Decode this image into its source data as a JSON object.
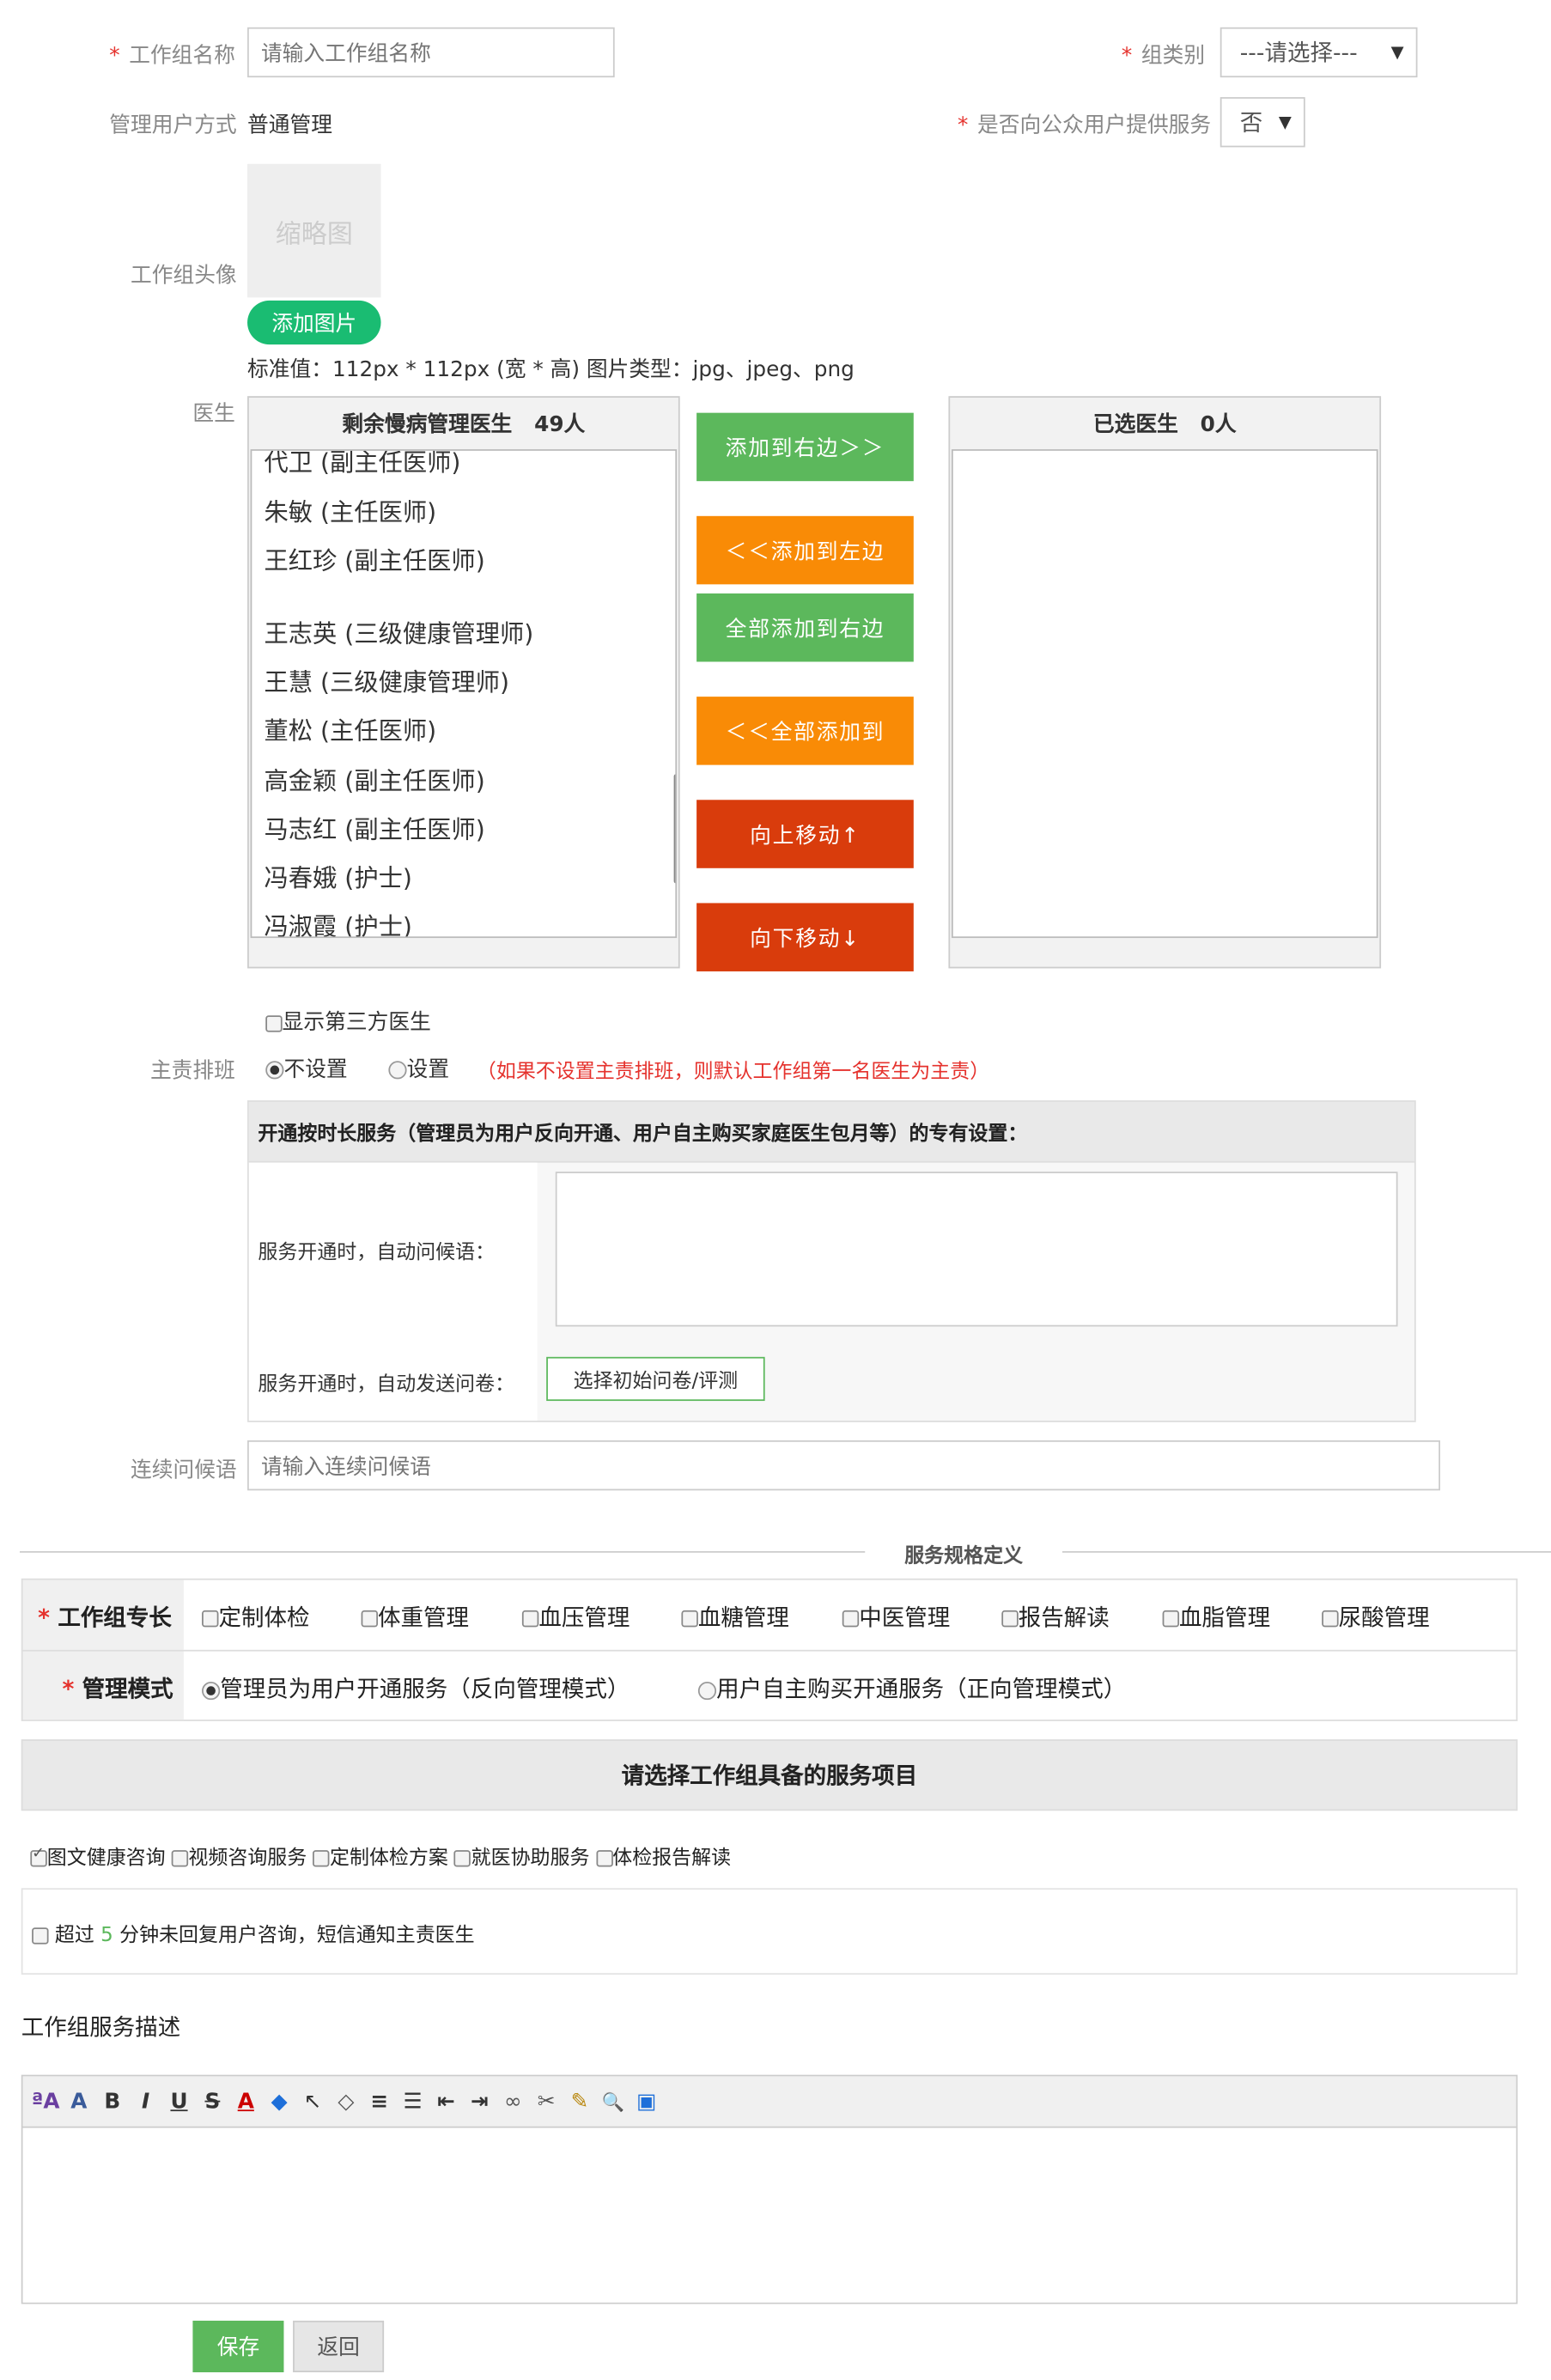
{
  "form": {
    "group_name": {
      "label": "工作组名称",
      "placeholder": "请输入工作组名称"
    },
    "group_type": {
      "label": "组类别",
      "value": "---请选择---"
    },
    "manage_mode": {
      "label": "管理用户方式",
      "value": "普通管理"
    },
    "public_service": {
      "label": "是否向公众用户提供服务",
      "value": "否"
    },
    "avatar": {
      "label": "工作组头像",
      "thumb_text": "缩略图",
      "add_btn": "添加图片",
      "hint": "标准值：112px * 112px (宽 * 高) 图片类型：jpg、jpeg、png"
    },
    "doctors": {
      "label": "医生",
      "left_title": "剩余慢病管理医生   49人",
      "right_title": "已选医生   0人",
      "list": [
        "代卫 (副主任医师)",
        "朱敏 (主任医师)",
        "王红珍 (副主任医师)",
        "",
        "王志英 (三级健康管理师)",
        "王慧 (三级健康管理师)",
        "董松 (主任医师)",
        "高金颖 (副主任医师)",
        "马志红 (副主任医师)",
        "冯春娥 (护士)",
        "冯淑霞 (护士)"
      ],
      "btn_add_right": "添加到右边＞＞",
      "btn_add_left": "＜＜添加到左边",
      "btn_add_all_right": "全部添加到右边",
      "btn_add_all_left": "＜＜全部添加到",
      "btn_up": "向上移动↑",
      "btn_down": "向下移动↓",
      "third_party": "显示第三方医生"
    },
    "duty": {
      "label": "主责排班",
      "opt_none": "不设置",
      "opt_set": "设置",
      "note": "（如果不设置主责排班，则默认工作组第一名医生为主责）"
    },
    "timed_service": {
      "header": "开通按时长服务（管理员为用户反向开通、用户自主购买家庭医生包月等）的专有设置：",
      "greeting_label": "服务开通时，自动问候语：",
      "survey_label": "服务开通时，自动发送问卷：",
      "survey_btn": "选择初始问卷/评测"
    },
    "continuous": {
      "label": "连续问候语",
      "placeholder": "请输入连续问候语"
    }
  },
  "spec": {
    "divider": "服务规格定义",
    "specialty_label": "工作组专长",
    "specialties": [
      "定制体检",
      "体重管理",
      "血压管理",
      "血糖管理",
      "中医管理",
      "报告解读",
      "血脂管理",
      "尿酸管理"
    ],
    "mode_label": "管理模式",
    "mode_opts": [
      "管理员为用户开通服务（反向管理模式）",
      "用户自主购买开通服务（正向管理模式）"
    ]
  },
  "services": {
    "header": "请选择工作组具备的服务项目",
    "items": [
      "图文健康咨询",
      "视频咨询服务",
      "定制体检方案",
      "就医协助服务",
      "体检报告解读"
    ],
    "timeout_pre": "超过",
    "timeout_num": "5",
    "timeout_post": "分钟未回复用户咨询，短信通知主责医生"
  },
  "description": {
    "title": "工作组服务描述",
    "toolbar": [
      "font-family-icon",
      "font-size-icon",
      "bold-icon",
      "italic-icon",
      "underline-icon",
      "strikethrough-icon",
      "font-color-icon",
      "highlight-icon",
      "select-icon",
      "eraser-icon",
      "align-icon",
      "list-icon",
      "outdent-icon",
      "indent-icon",
      "link-icon",
      "unlink-icon",
      "edit-icon",
      "preview-icon",
      "fullscreen-icon"
    ],
    "toolbar_glyphs": [
      "ªA",
      "A",
      "B",
      "I",
      "U",
      "S",
      "A",
      "◆",
      "↖",
      "◇",
      "≡",
      "☰",
      "⇤",
      "⇥",
      "∞",
      "✂",
      "✎",
      "🔍",
      "▣"
    ]
  },
  "actions": {
    "save": "保存",
    "back": "返回"
  },
  "colors": {
    "green": "#5cb85c",
    "orange": "#f98b06",
    "red": "#d93c0c",
    "avatar_btn": "#1abc72"
  }
}
